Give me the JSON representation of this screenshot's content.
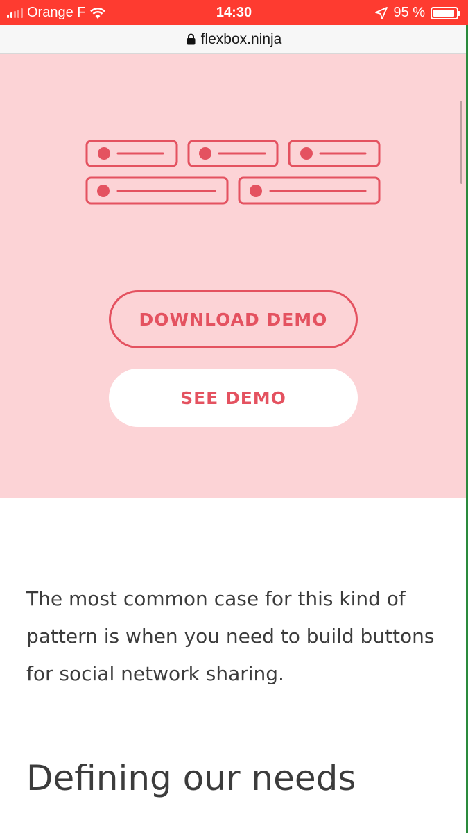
{
  "status_bar": {
    "carrier": "Orange F",
    "time": "14:30",
    "battery_percent": "95 %",
    "battery_level": 0.95
  },
  "url_bar": {
    "url": "flexbox.ninja"
  },
  "hero": {
    "icon": "social-buttons-illustration",
    "download_label": "DOWNLOAD DEMO",
    "see_demo_label": "SEE DEMO"
  },
  "article": {
    "paragraph": "The most common case for this kind of pattern is when you need to build buttons for social network sharing.",
    "heading": "Defining our needs"
  },
  "colors": {
    "status_bar": "#fe3b30",
    "hero_bg": "#fcd3d6",
    "accent": "#e45260",
    "text": "#3c3c3c"
  }
}
